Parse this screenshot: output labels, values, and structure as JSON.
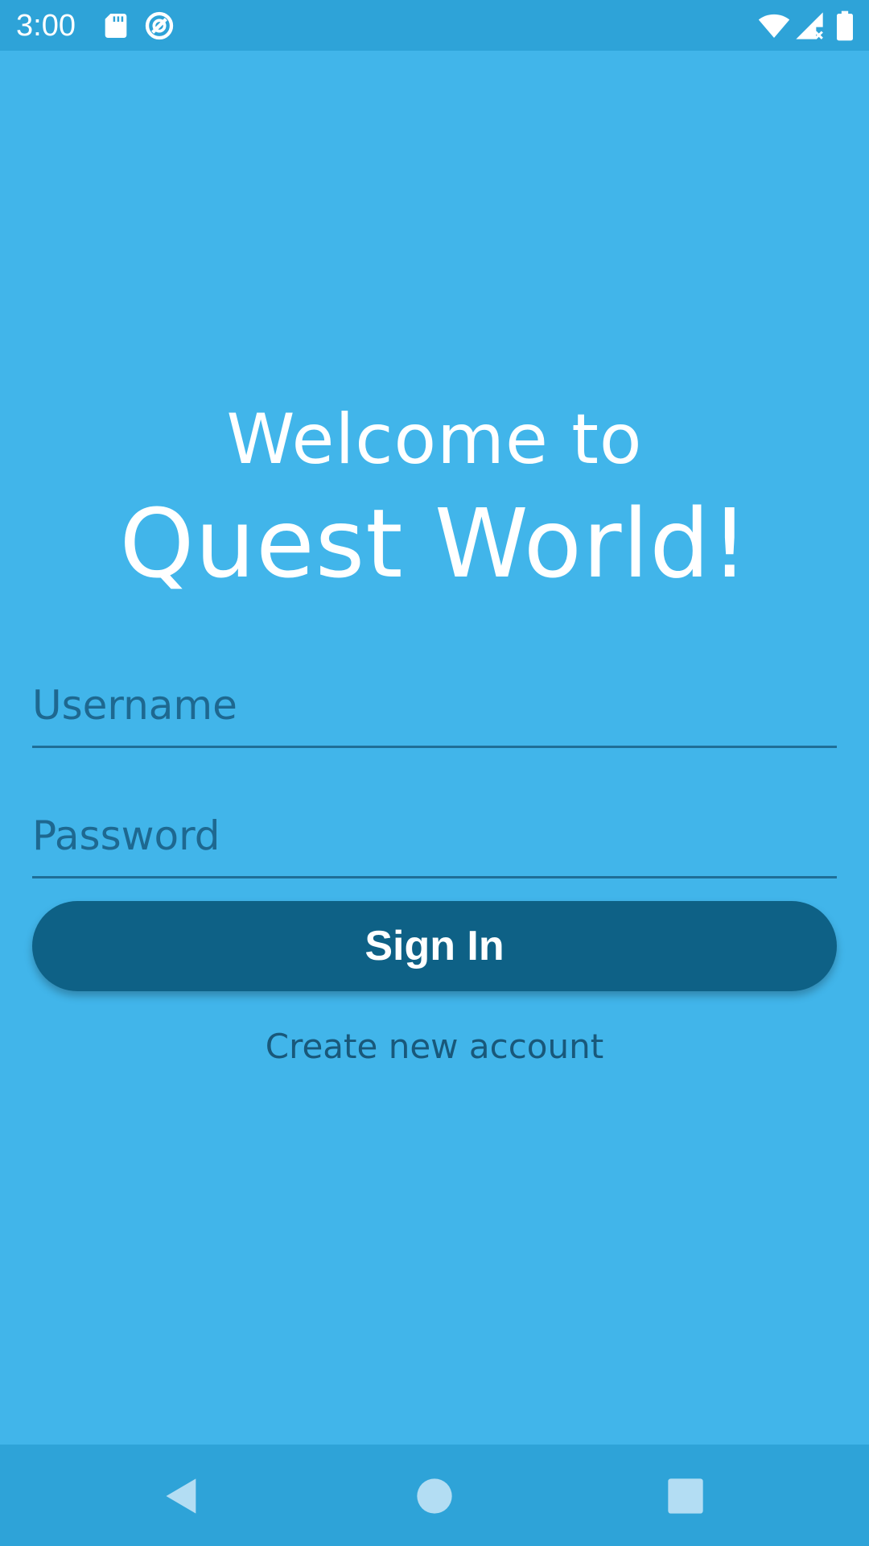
{
  "status_bar": {
    "time": "3:00",
    "left_icons": [
      "sd-card-icon",
      "data-saver-icon"
    ],
    "right_icons": [
      "wifi-icon",
      "signal-no-data-icon",
      "battery-icon"
    ]
  },
  "welcome": {
    "line1": "Welcome to",
    "line2": "Quest World!"
  },
  "form": {
    "username_placeholder": "Username",
    "username_value": "",
    "password_placeholder": "Password",
    "password_value": ""
  },
  "actions": {
    "sign_in_label": "Sign In",
    "create_account_label": "Create new account"
  },
  "nav_bar": {
    "buttons": [
      "back-icon",
      "home-icon",
      "recents-icon"
    ]
  },
  "colors": {
    "background": "#41b5ea",
    "bars": "#2ea3d8",
    "button": "#0e6186",
    "text_light": "#ffffff",
    "text_dark": "#19587a"
  }
}
